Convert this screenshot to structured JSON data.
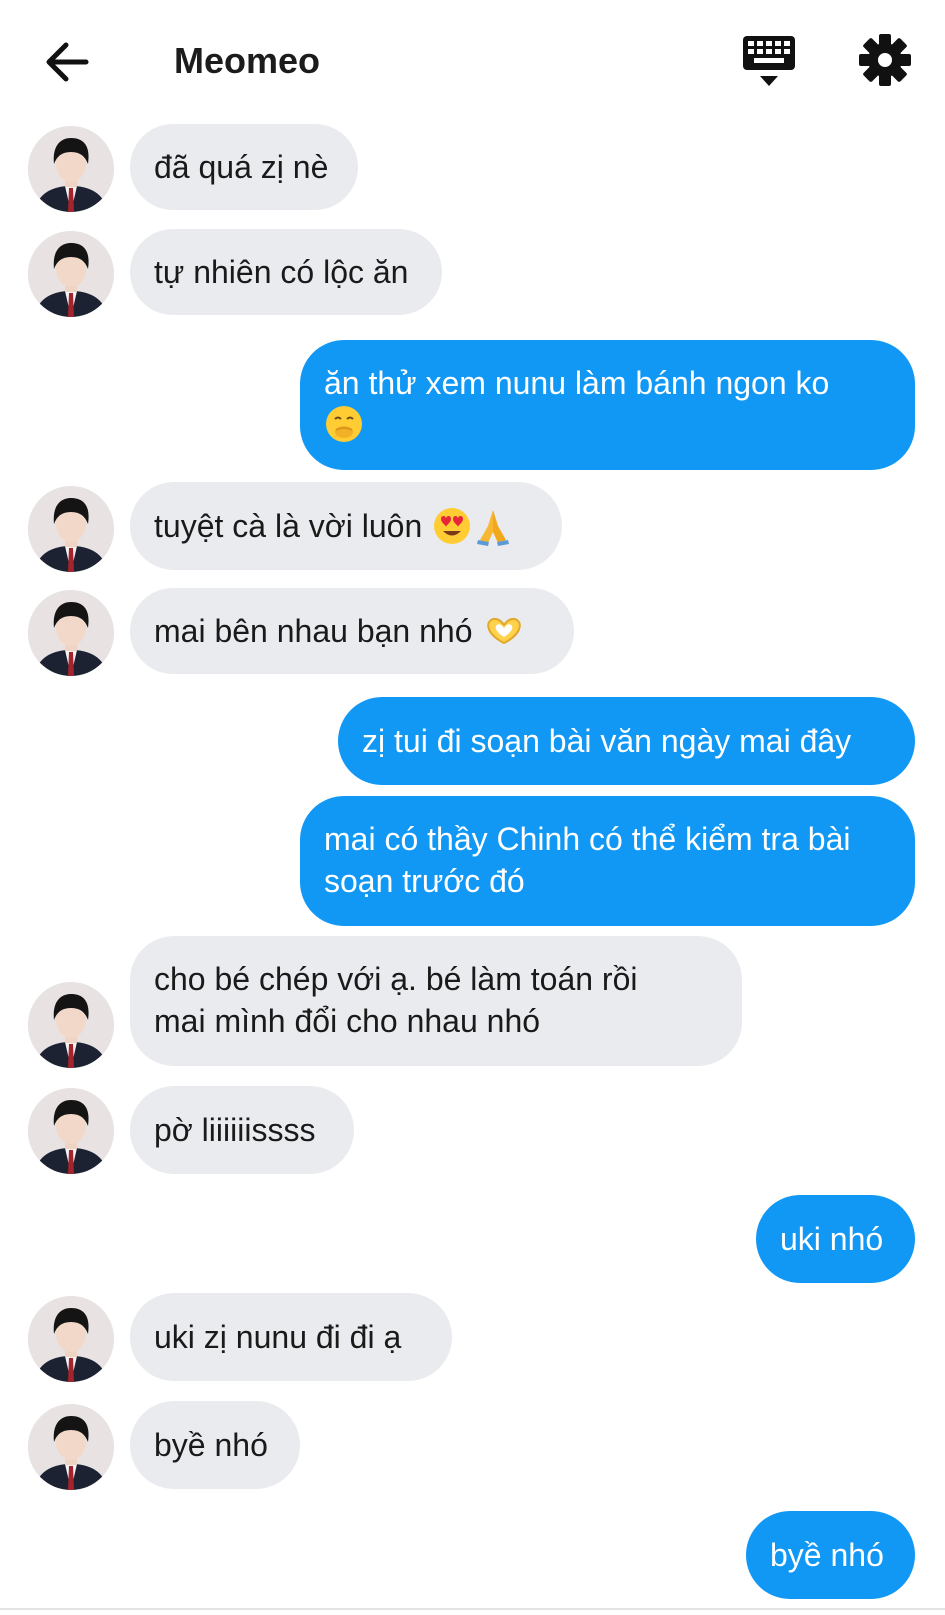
{
  "header": {
    "title": "Meomeo",
    "back_icon": "arrow-left-icon",
    "keyboard_icon": "keyboard-icon",
    "settings_icon": "gear-icon"
  },
  "colors": {
    "outgoing_bubble": "#1198f5",
    "incoming_bubble": "#e9ebee",
    "outgoing_text": "#ffffff",
    "incoming_text": "#1a1a1a"
  },
  "messages": [
    {
      "from": "them",
      "text": "đã quá zị nè"
    },
    {
      "from": "them",
      "text": "tự nhiên có lộc ăn"
    },
    {
      "from": "me",
      "text": "ăn thử xem nunu làm bánh ngon ko",
      "emoji": "hand-over-mouth-emoji"
    },
    {
      "from": "them",
      "text": "tuyệt cà là vời luôn",
      "emoji": "heart-eyes-and-folded-hands-emoji"
    },
    {
      "from": "them",
      "text": "mai bên nhau bạn nhó",
      "emoji": "heart-hands-emoji"
    },
    {
      "from": "me",
      "text": "zị tui đi soạn bài văn ngày mai đây"
    },
    {
      "from": "me",
      "text": "mai có thầy Chinh có thể kiểm tra bài soạn trước đó"
    },
    {
      "from": "them",
      "text": "cho bé chép với ạ. bé làm toán rồi mai mình đổi cho nhau nhó"
    },
    {
      "from": "them",
      "text": "pờ liiiiiissss"
    },
    {
      "from": "me",
      "text": "uki nhó"
    },
    {
      "from": "them",
      "text": "uki zị nunu đi đi ạ"
    },
    {
      "from": "them",
      "text": "byề nhó"
    },
    {
      "from": "me",
      "text": "byề nhó"
    }
  ]
}
